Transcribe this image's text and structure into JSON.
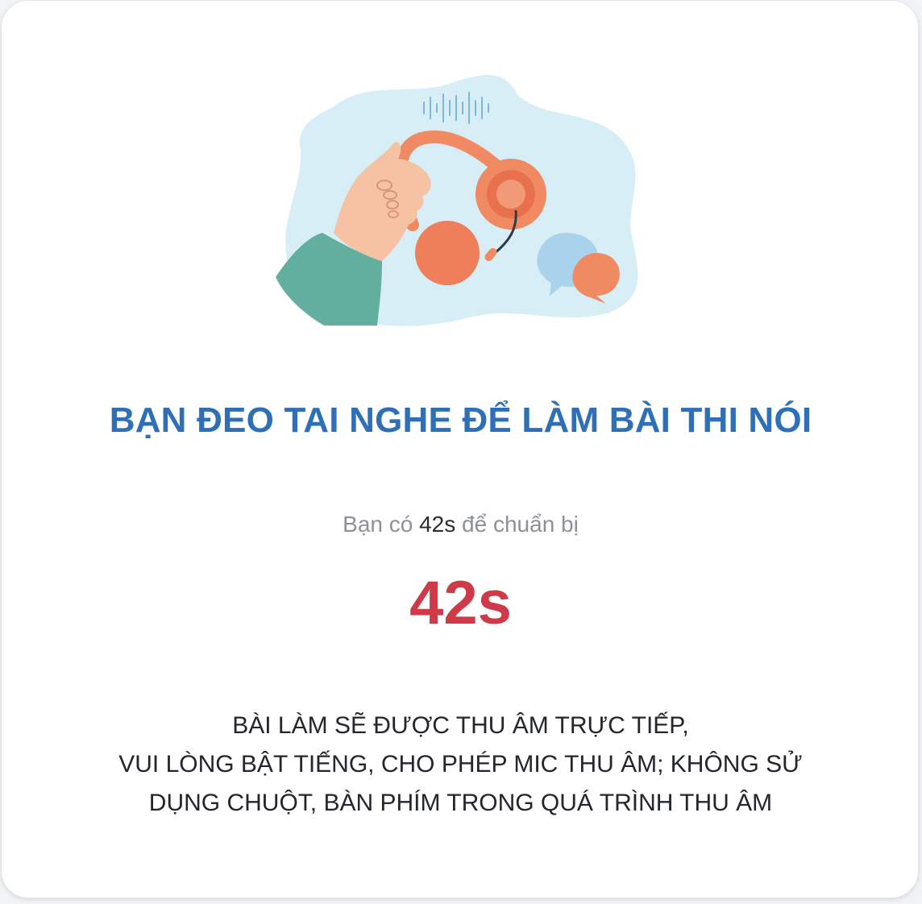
{
  "dialog": {
    "title": "BẠN ĐEO TAI NGHE ĐỂ LÀM BÀI THI NÓI",
    "prep_prefix": "Bạn có",
    "prep_value": "42s",
    "prep_suffix": "để chuẩn bị",
    "countdown": "42s",
    "notice_lines": [
      "BÀI LÀM SẼ ĐƯỢC THU ÂM TRỰC TIẾP,",
      "VUI LÒNG BẬT TIẾNG, CHO PHÉP MIC THU ÂM; KHÔNG SỬ",
      "DỤNG CHUỘT, BÀN PHÍM TRONG QUÁ TRÌNH THU ÂM"
    ]
  },
  "illustration": {
    "icon": "headphones-hand-icon",
    "colors": {
      "blob": "#d8eef7",
      "headphone": "#ef8a62",
      "sleeve": "#62ae9f",
      "skin": "#f5c3a3",
      "bubble_blue": "#a9d3ec"
    }
  },
  "colors": {
    "title": "#2f6fb8",
    "countdown": "#cf3a48",
    "muted": "#8d9097"
  }
}
